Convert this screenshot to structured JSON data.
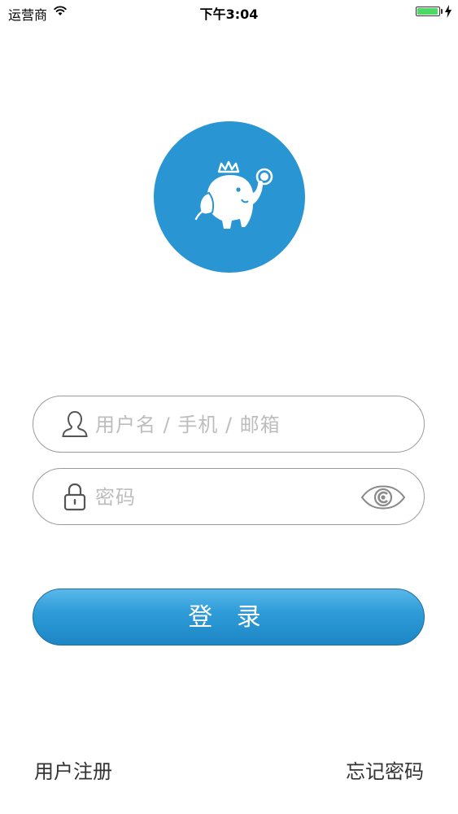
{
  "status_bar": {
    "carrier": "运营商",
    "time": "下午3:04",
    "battery_level": 0.95,
    "icons": [
      "wifi-icon",
      "battery-icon",
      "charging-bolt-icon"
    ]
  },
  "logo": {
    "icon": "crowned-elephant-logo",
    "color": "#2996d3"
  },
  "username_field": {
    "value": "",
    "placeholder": "用户名 / 手机 / 邮箱",
    "icon": "user-icon"
  },
  "password_field": {
    "value": "",
    "placeholder": "密码",
    "icon": "lock-icon",
    "toggle_icon": "eye-icon"
  },
  "login_button": {
    "label": "登 录",
    "color": "#2f9cd8"
  },
  "links": {
    "register": "用户注册",
    "forgot_password": "忘记密码"
  }
}
